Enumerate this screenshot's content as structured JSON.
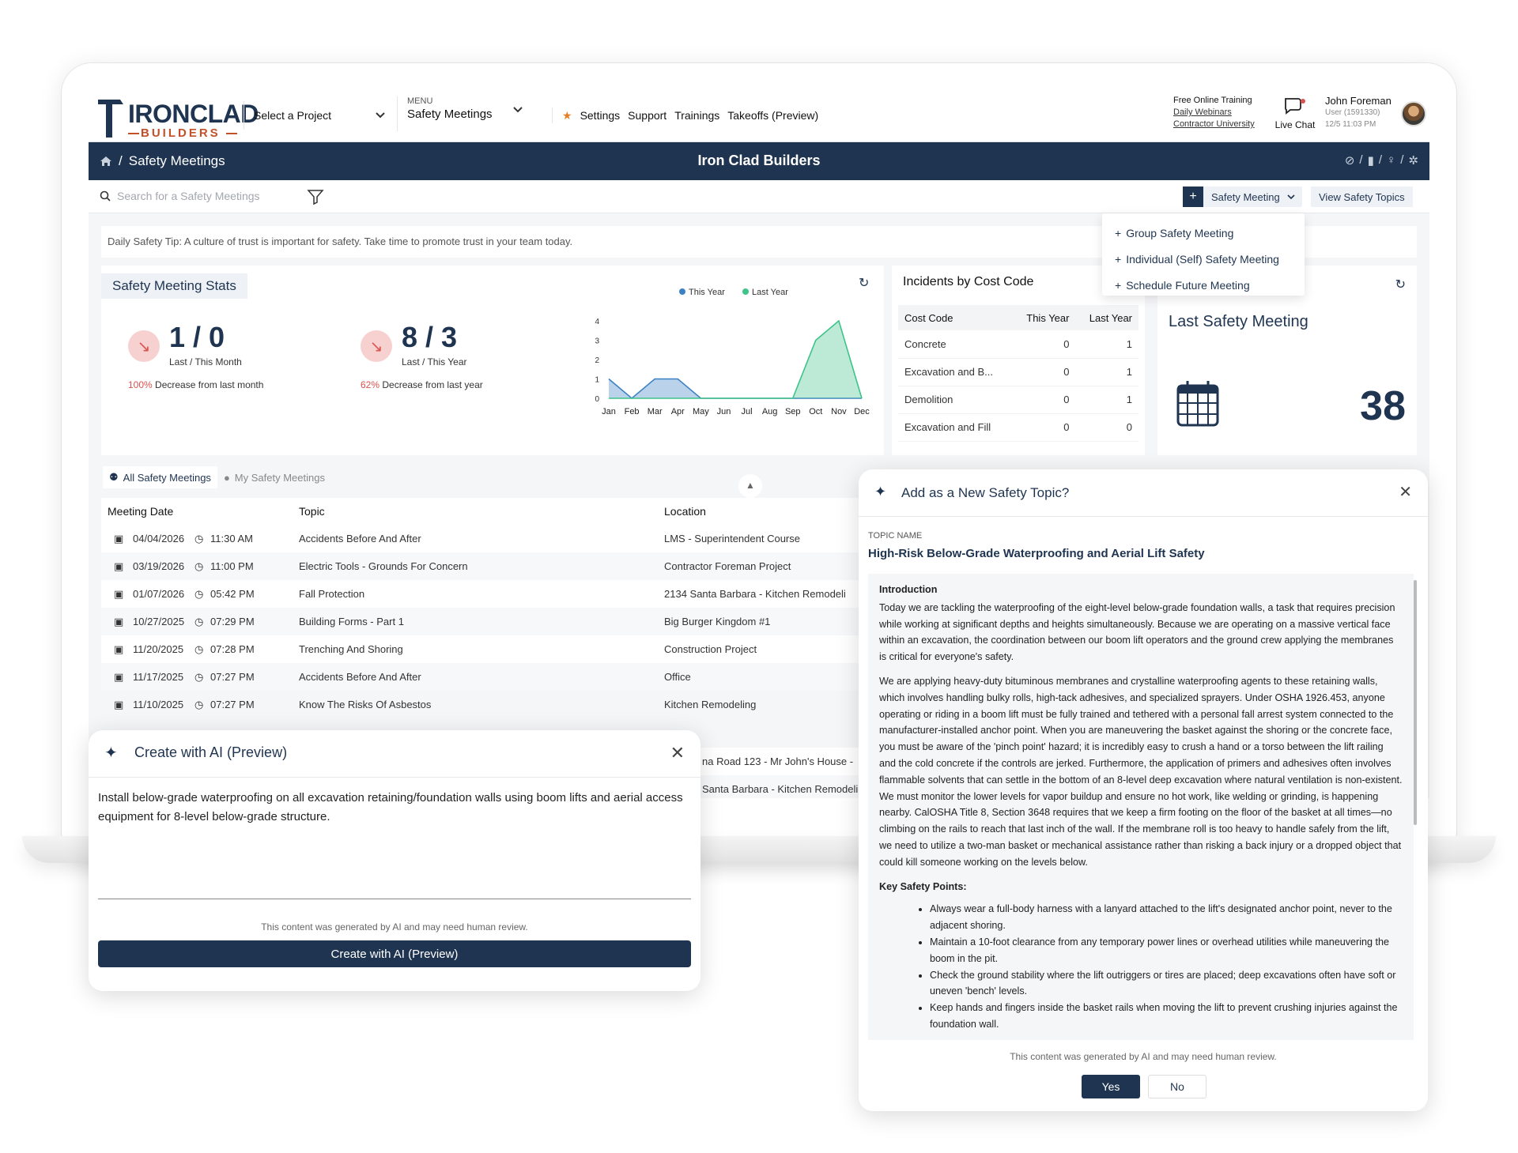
{
  "header": {
    "logo_text": "IRONCLAD",
    "logo_sub": "BUILDERS",
    "project_select": "Select a Project",
    "menu_label": "MENU",
    "menu_value": "Safety Meetings",
    "nav_links": [
      "Settings",
      "Support",
      "Trainings",
      "Takeoffs (Preview)"
    ],
    "training_title": "Free Online Training",
    "training_links": [
      "Daily Webinars",
      "Contractor University"
    ],
    "live_chat": "Live Chat",
    "user_name": "John Foreman",
    "user_id": "User (1591330)",
    "user_time": "12/5 11:03 PM"
  },
  "navbar": {
    "breadcrumb": "Safety Meetings",
    "company": "Iron Clad Builders"
  },
  "search": {
    "placeholder": "Search for a Safety Meetings",
    "add_button": "Safety Meeting",
    "view_topics": "View Safety Topics"
  },
  "dropdown": {
    "items": [
      "Group Safety Meeting",
      "Individual (Self) Safety Meeting",
      "Schedule Future Meeting"
    ]
  },
  "tip": "Daily Safety Tip: A culture of trust is important for safety. Take time to promote trust in your team today.",
  "stats": {
    "title": "Safety Meeting Stats",
    "month_value": "1 / 0",
    "month_label": "Last / This Month",
    "month_pct": "100%",
    "month_desc": "Decrease from last month",
    "year_value": "8 / 3",
    "year_label": "Last / This Year",
    "year_pct": "62%",
    "year_desc": "Decrease from last year"
  },
  "chart_data": {
    "type": "area",
    "categories": [
      "Jan",
      "Feb",
      "Mar",
      "Apr",
      "May",
      "Jun",
      "Jul",
      "Aug",
      "Sep",
      "Oct",
      "Nov",
      "Dec"
    ],
    "series": [
      {
        "name": "This Year",
        "values": [
          1,
          0,
          1,
          1,
          0,
          0,
          0,
          0,
          0,
          0,
          0,
          0
        ],
        "color": "#3b82c4"
      },
      {
        "name": "Last Year",
        "values": [
          0,
          0,
          0,
          0,
          0,
          0,
          0,
          0,
          0,
          3,
          4,
          0
        ],
        "color": "#3ec389"
      }
    ],
    "ylim": [
      0,
      4
    ],
    "yticks": [
      "0",
      "1",
      "2",
      "3",
      "4"
    ],
    "legend": "top"
  },
  "incidents": {
    "title": "Incidents by Cost Code",
    "columns": [
      "Cost Code",
      "This Year",
      "Last Year"
    ],
    "rows": [
      [
        "Concrete",
        "0",
        "1"
      ],
      [
        "Excavation and B...",
        "0",
        "1"
      ],
      [
        "Demolition",
        "0",
        "1"
      ],
      [
        "Excavation and Fill",
        "0",
        "0"
      ]
    ]
  },
  "last_meeting": {
    "title": "Last Safety Meeting",
    "count": "38"
  },
  "tabs": [
    "All Safety Meetings",
    "My Safety Meetings"
  ],
  "meetings": {
    "columns": [
      "Meeting Date",
      "Topic",
      "Location"
    ],
    "rows": [
      {
        "date": "04/04/2026",
        "time": "11:30 AM",
        "topic": "Accidents Before And After",
        "location": "LMS - Superintendent Course"
      },
      {
        "date": "03/19/2026",
        "time": "11:00 PM",
        "topic": "Electric Tools - Grounds For Concern",
        "location": "Contractor Foreman Project"
      },
      {
        "date": "01/07/2026",
        "time": "05:42 PM",
        "topic": "Fall Protection",
        "location": "2134 Santa Barbara - Kitchen Remodeli"
      },
      {
        "date": "10/27/2025",
        "time": "07:29 PM",
        "topic": "Building Forms - Part 1",
        "location": "Big Burger Kingdom #1"
      },
      {
        "date": "11/20/2025",
        "time": "07:28 PM",
        "topic": "Trenching And Shoring",
        "location": "Construction Project"
      },
      {
        "date": "11/17/2025",
        "time": "07:27 PM",
        "topic": "Accidents Before And After",
        "location": "Office"
      },
      {
        "date": "11/10/2025",
        "time": "07:27 PM",
        "topic": "Know The Risks Of Asbestos",
        "location": "Kitchen Remodeling"
      }
    ],
    "peek_rows": [
      "na Road 123 - Mr John's House -",
      "Santa Barbara - Kitchen Remodeli"
    ]
  },
  "ai_panel": {
    "title": "Create with AI (Preview)",
    "input_value": "Install below-grade waterproofing on all excavation retaining/foundation walls using boom lifts and aerial access equipment for 8-level below-grade structure.",
    "note": "This content was generated by AI and may need human review.",
    "button": "Create with AI (Preview)"
  },
  "topic_panel": {
    "title": "Add as a New Safety Topic?",
    "label": "TOPIC NAME",
    "name": "High-Risk Below-Grade Waterproofing and Aerial Lift Safety",
    "intro_heading": "Introduction",
    "intro_p1": "Today we are tackling the waterproofing of the eight-level below-grade foundation walls, a task that requires precision while working at significant depths and heights simultaneously. Because we are operating on a massive vertical face within an excavation, the coordination between our boom lift operators and the ground crew applying the membranes is critical for everyone's safety.",
    "intro_p2": "We are applying heavy-duty bituminous membranes and crystalline waterproofing agents to these retaining walls, which involves handling bulky rolls, high-tack adhesives, and specialized sprayers. Under OSHA 1926.453, anyone operating or riding in a boom lift must be fully trained and tethered with a personal fall arrest system connected to the manufacturer-installed anchor point. When you are maneuvering the basket against the shoring or the concrete face, you must be aware of the 'pinch point' hazard; it is incredibly easy to crush a hand or a torso between the lift railing and the cold concrete if the controls are jerked. Furthermore, the application of primers and adhesives often involves flammable solvents that can settle in the bottom of an 8-level deep excavation where natural ventilation is non-existent. We must monitor the lower levels for vapor buildup and ensure no hot work, like welding or grinding, is happening nearby. CalOSHA Title 8, Section 3648 requires that we keep a firm footing on the floor of the basket at all times—no climbing on the rails to reach that last inch of the wall. If the membrane roll is too heavy to handle safely from the lift, we need to utilize a two-man basket or mechanical assistance rather than risking a back injury or a dropped object that could kill someone working on the levels below.",
    "points_heading": "Key Safety Points:",
    "points": [
      "Always wear a full-body harness with a lanyard attached to the lift's designated anchor point, never to the adjacent shoring.",
      "Maintain a 10-foot clearance from any temporary power lines or overhead utilities while maneuvering the boom in the pit.",
      "Check the ground stability where the lift outriggers or tires are placed; deep excavations often have soft or uneven 'bench' levels.",
      "Keep hands and fingers inside the basket rails when moving the lift to prevent crushing injuries against the foundation wall."
    ],
    "note": "This content was generated by AI and may need human review.",
    "yes": "Yes",
    "no": "No"
  },
  "colors": {
    "brand_navy": "#1f3451",
    "brand_orange": "#c2512a",
    "decrease_red": "#d9534f"
  }
}
